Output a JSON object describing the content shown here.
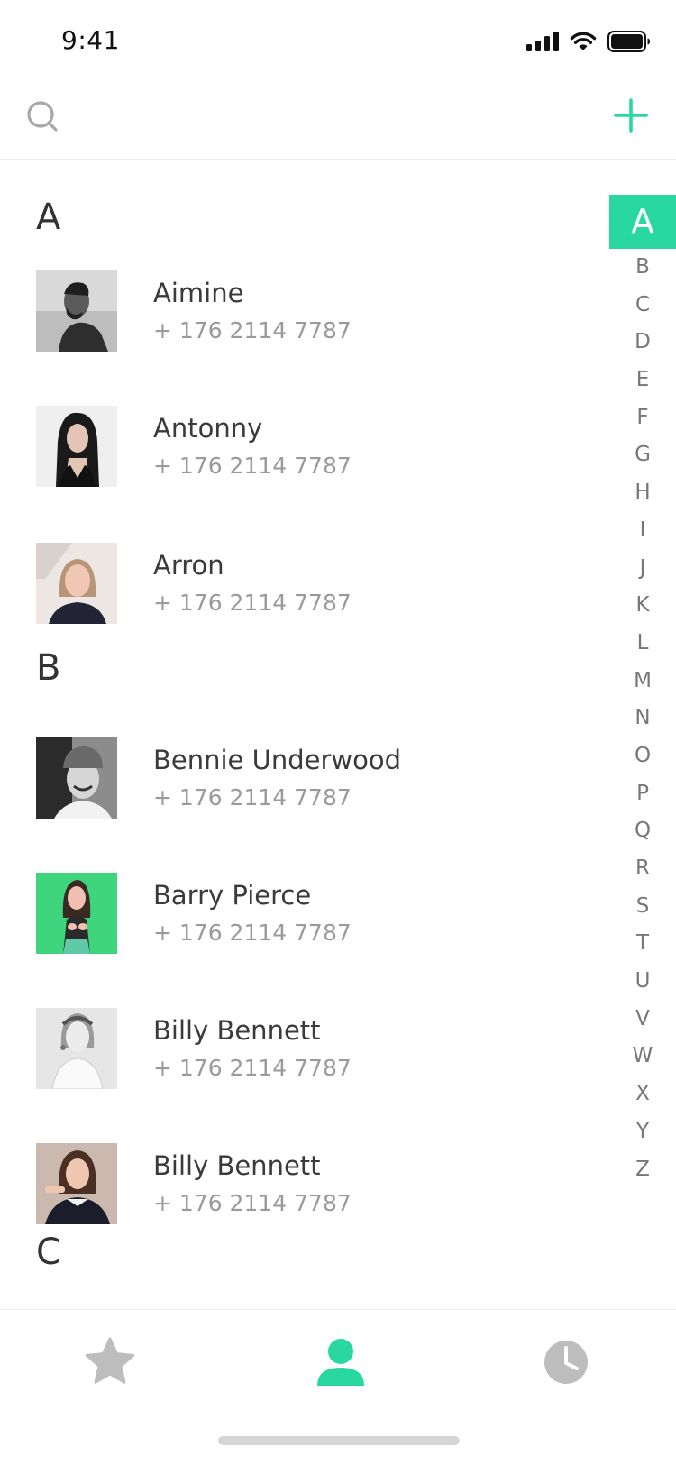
{
  "status_bar": {
    "time": "9:41"
  },
  "colors": {
    "accent": "#29d89e",
    "muted": "#9a9a9a",
    "tab_inactive": "#bdbdbd"
  },
  "top_bar": {
    "search_icon": "search-icon",
    "add_icon": "plus-icon"
  },
  "sections": [
    {
      "letter": "A",
      "contacts": [
        {
          "name": "Aimine",
          "phone": "+ 176 2114 7787"
        },
        {
          "name": "Antonny",
          "phone": "+ 176 2114 7787"
        },
        {
          "name": "Arron",
          "phone": "+ 176 2114 7787"
        }
      ]
    },
    {
      "letter": "B",
      "contacts": [
        {
          "name": "Bennie Underwood",
          "phone": "+ 176 2114 7787"
        },
        {
          "name": "Barry Pierce",
          "phone": "+ 176 2114 7787"
        },
        {
          "name": "Billy Bennett",
          "phone": "+ 176 2114 7787"
        },
        {
          "name": "Billy Bennett",
          "phone": "+ 176 2114 7787"
        }
      ]
    },
    {
      "letter": "C",
      "contacts": []
    }
  ],
  "alphabet": [
    "A",
    "B",
    "C",
    "D",
    "E",
    "F",
    "G",
    "H",
    "I",
    "J",
    "K",
    "L",
    "M",
    "N",
    "O",
    "P",
    "Q",
    "R",
    "S",
    "T",
    "U",
    "V",
    "W",
    "X",
    "Y",
    "Z"
  ],
  "alphabet_active": "A",
  "tabs": [
    {
      "icon": "star-icon",
      "active": false
    },
    {
      "icon": "person-icon",
      "active": true
    },
    {
      "icon": "clock-icon",
      "active": false
    }
  ]
}
